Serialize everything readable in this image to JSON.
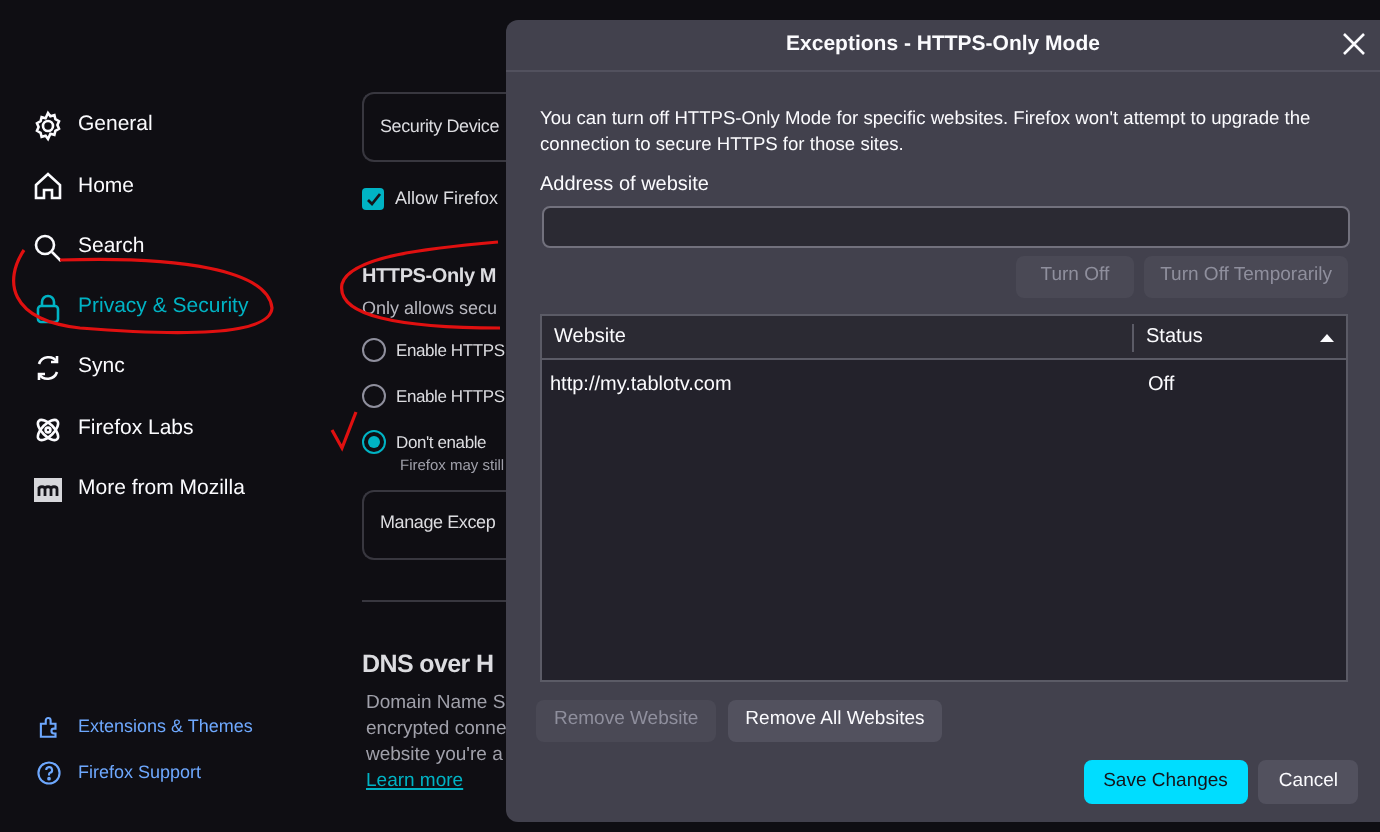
{
  "sidebar": {
    "items": [
      {
        "label": "General",
        "selected": false
      },
      {
        "label": "Home",
        "selected": false
      },
      {
        "label": "Search",
        "selected": false
      },
      {
        "label": "Privacy & Security",
        "selected": true
      },
      {
        "label": "Sync",
        "selected": false
      },
      {
        "label": "Firefox Labs",
        "selected": false
      },
      {
        "label": "More from Mozilla",
        "selected": false
      }
    ],
    "footer_items": [
      {
        "label": "Extensions & Themes"
      },
      {
        "label": "Firefox Support"
      }
    ]
  },
  "settings": {
    "security_devices_button": "Security Device",
    "allow_checkbox": {
      "label": "Allow Firefox",
      "checked": true
    },
    "https_heading": "HTTPS-Only M",
    "https_subtitle": "Only allows secu",
    "radios": [
      {
        "label": "Enable HTTPS",
        "selected": false
      },
      {
        "label": "Enable HTTPS",
        "selected": false
      },
      {
        "label": "Don't enable",
        "selected": true
      }
    ],
    "radio_note": "Firefox may still",
    "manage_button": "Manage Excep",
    "dns_heading": "DNS over H",
    "dns_text": [
      "Domain Name S",
      "encrypted conne",
      "website you're a"
    ],
    "learn_more": "Learn more"
  },
  "dialog": {
    "title": "Exceptions - HTTPS-Only Mode",
    "description": "You can turn off HTTPS-Only Mode for specific websites. Firefox won't attempt to upgrade the connection to secure HTTPS for those sites.",
    "address_label": "Address of website",
    "address_buttons": [
      {
        "label": "Turn Off",
        "disabled": true
      },
      {
        "label": "Turn Off Temporarily",
        "disabled": true
      }
    ],
    "table": {
      "columns": [
        {
          "label": "Website",
          "sorted": false
        },
        {
          "label": "Status",
          "sorted": true
        }
      ],
      "rows": [
        {
          "website": "http://my.tablotv.com",
          "status": "Off",
          "selected": false
        }
      ]
    },
    "remove_buttons": [
      {
        "label": "Remove Website",
        "disabled": true
      },
      {
        "label": "Remove All Websites",
        "disabled": false
      }
    ],
    "footer_buttons": [
      {
        "label": "Save Changes",
        "kind": "primary"
      },
      {
        "label": "Cancel",
        "kind": "secondary"
      }
    ]
  }
}
